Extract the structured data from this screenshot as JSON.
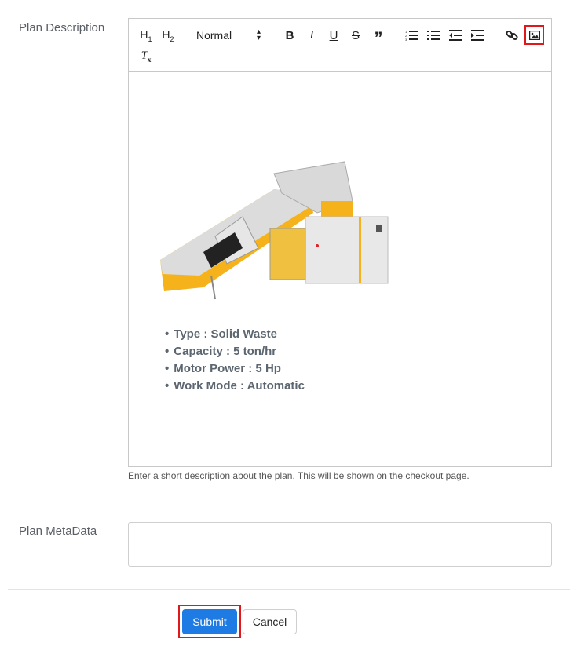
{
  "form": {
    "description_label": "Plan Description",
    "description_help": "Enter a short description about the plan. This will be shown on the checkout page.",
    "metadata_label": "Plan MetaData",
    "metadata_value": "",
    "submit_label": "Submit",
    "cancel_label": "Cancel"
  },
  "toolbar": {
    "h1_label": "H1",
    "h2_label": "H2",
    "format_select": "Normal",
    "highlighted_button": "image-button"
  },
  "editor_content": {
    "image_alt": "Industrial shredder machine with yellow conveyor",
    "specs": [
      "Type : Solid Waste",
      "Capacity : 5 ton/hr",
      "Motor Power : 5 Hp",
      "Work Mode : Automatic"
    ]
  },
  "colors": {
    "primary": "#1e7be3",
    "highlight": "#e0181e",
    "machine_yellow": "#f5b21a"
  }
}
